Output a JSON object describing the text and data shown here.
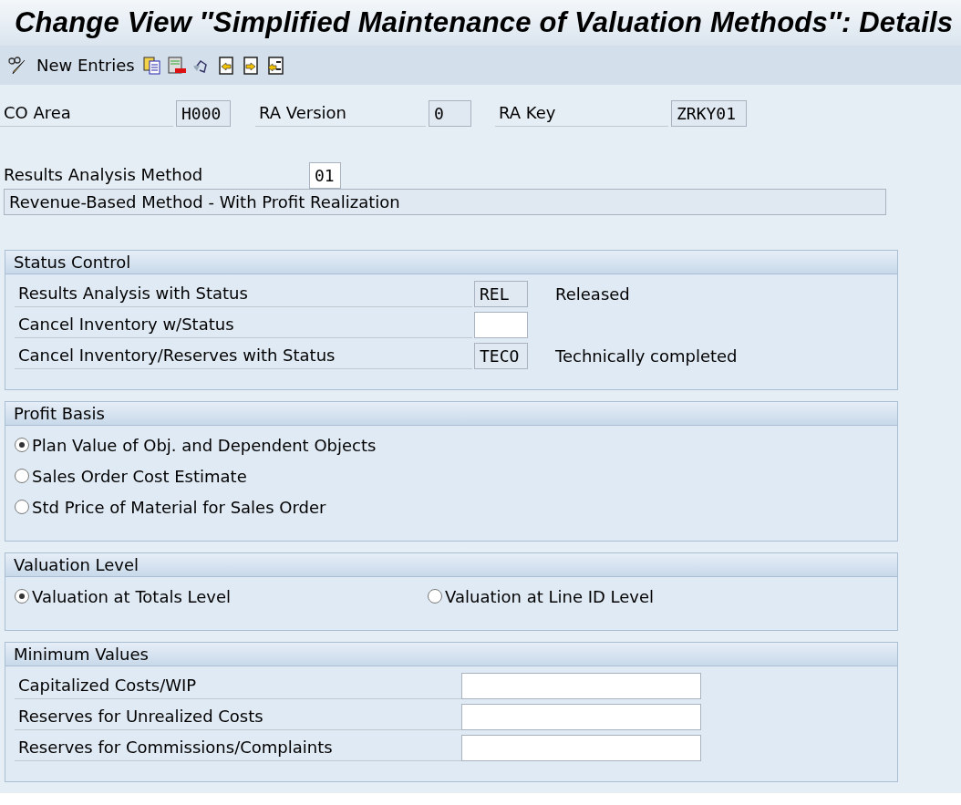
{
  "window": {
    "title": "Change View ″Simplified Maintenance of Valuation Methods″: Details"
  },
  "toolbar": {
    "new_entries": "New Entries"
  },
  "header_fields": [
    {
      "label": "CO Area",
      "value": "H000"
    },
    {
      "label": "RA Version",
      "value": "0"
    },
    {
      "label": "RA Key",
      "value": "ZRKY01"
    }
  ],
  "method": {
    "label": "Results Analysis Method",
    "value": "01",
    "description": "Revenue-Based Method - With Profit Realization"
  },
  "groups": [
    {
      "kind": "fields",
      "title": "Status Control",
      "rows": [
        {
          "label": "Results Analysis with Status",
          "value": "REL",
          "text": "Released"
        },
        {
          "label": "Cancel Inventory w/Status"
        },
        {
          "label": "Cancel Inventory/Reserves with Status",
          "value": "TECO",
          "text": "Technically completed"
        }
      ]
    },
    {
      "kind": "radios",
      "title": "Profit Basis",
      "options": [
        {
          "label": "Plan Value of Obj. and Dependent Objects",
          "selected": true
        },
        {
          "label": "Sales Order Cost Estimate",
          "selected": false
        },
        {
          "label": "Std Price of Material for Sales Order",
          "selected": false
        }
      ]
    },
    {
      "kind": "radio_row",
      "title": "Valuation Level",
      "options": [
        {
          "label": "Valuation at Totals Level",
          "selected": true
        },
        {
          "label": "Valuation at Line ID Level",
          "selected": false
        }
      ]
    },
    {
      "kind": "amounts",
      "title": "Minimum Values",
      "rows": [
        {
          "label": "Capitalized Costs/WIP"
        },
        {
          "label": "Reserves for Unrealized Costs"
        },
        {
          "label": "Reserves for Commissions/Complaints"
        }
      ]
    }
  ]
}
